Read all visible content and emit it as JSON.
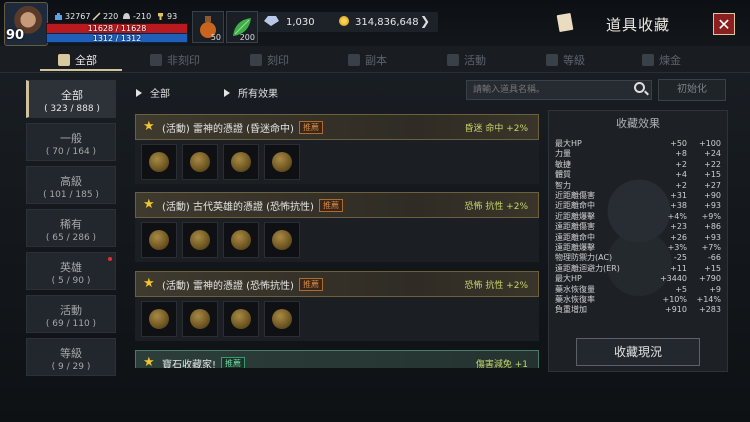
{
  "player": {
    "level": "90",
    "power": "32767",
    "attack": "220",
    "defense": "-210",
    "trophies": "93",
    "hp_text": "11628 / 11628",
    "mp_text": "1312 / 1312",
    "hp_fraction": 1.0,
    "mp_fraction": 1.0
  },
  "slots": [
    {
      "icon": "potion-icon",
      "qty": "50"
    },
    {
      "icon": "herb-icon",
      "qty": "200"
    }
  ],
  "currency": {
    "gems": "1,030",
    "gold": "314,836,648"
  },
  "header": {
    "title": "道具收藏"
  },
  "tabs": [
    {
      "label": "全部",
      "icon": "grid-icon",
      "active": true
    },
    {
      "label": "非刻印",
      "icon": "lock-icon"
    },
    {
      "label": "刻印",
      "icon": "lock-icon"
    },
    {
      "label": "副本",
      "icon": "gate-icon"
    },
    {
      "label": "活動",
      "icon": "sword-icon"
    },
    {
      "label": "等級",
      "icon": "level-icon"
    },
    {
      "label": "煉金",
      "icon": "gear-icon"
    }
  ],
  "categories": [
    {
      "name": "全部",
      "count": "( 323 / 888 )",
      "active": true
    },
    {
      "name": "一般",
      "count": "( 70 / 164 )"
    },
    {
      "name": "高級",
      "count": "( 101 / 185 )"
    },
    {
      "name": "稀有",
      "count": "( 65 / 286 )"
    },
    {
      "name": "英雄",
      "count": "( 5 / 90 )",
      "dot": true
    },
    {
      "name": "活動",
      "count": "( 69 / 110 )"
    },
    {
      "name": "等級",
      "count": "( 9 / 29 )"
    }
  ],
  "filters": {
    "all": "全部",
    "effect": "所有效果"
  },
  "search": {
    "placeholder": "請輸入道具名稱。"
  },
  "reset_label": "初始化",
  "sets": [
    {
      "name": "(活動) 雷神的憑證 (昏迷命中)",
      "tag": "推薦",
      "effect": "昏迷 命中 +2%",
      "items": 4
    },
    {
      "name": "(活動) 古代英雄的憑證 (恐怖抗性)",
      "tag": "推薦",
      "effect": "恐怖 抗性 +2%",
      "items": 4
    },
    {
      "name": "(活動) 雷神的憑證 (恐怖抗性)",
      "tag": "推薦",
      "effect": "恐怖 抗性 +2%",
      "items": 4
    },
    {
      "name": "寶石收藏家!",
      "tag": "推薦",
      "effect": "傷害減免 +1",
      "items": 0,
      "green": true
    }
  ],
  "panel": {
    "title": "收藏效果",
    "stats": [
      {
        "name": "最大HP",
        "v1": "+50",
        "v2": "+100"
      },
      {
        "name": "力量",
        "v1": "+8",
        "v2": "+24"
      },
      {
        "name": "敏捷",
        "v1": "+2",
        "v2": "+22"
      },
      {
        "name": "體質",
        "v1": "+4",
        "v2": "+15"
      },
      {
        "name": "智力",
        "v1": "+2",
        "v2": "+27"
      },
      {
        "name": "近距離傷害",
        "v1": "+31",
        "v2": "+90"
      },
      {
        "name": "近距離命中",
        "v1": "+38",
        "v2": "+93"
      },
      {
        "name": "近距離爆擊",
        "v1": "+4%",
        "v2": "+9%"
      },
      {
        "name": "遠距離傷害",
        "v1": "+23",
        "v2": "+86"
      },
      {
        "name": "遠距離命中",
        "v1": "+26",
        "v2": "+93"
      },
      {
        "name": "遠距離爆擊",
        "v1": "+3%",
        "v2": "+7%"
      },
      {
        "name": "物理防禦力(AC)",
        "v1": "-25",
        "v2": "-66"
      },
      {
        "name": "遠距離迴避力(ER)",
        "v1": "+11",
        "v2": "+15"
      },
      {
        "name": "最大HP",
        "v1": "+3440",
        "v2": "+790"
      },
      {
        "name": "藥水恢復量",
        "v1": "+5",
        "v2": "+9"
      },
      {
        "name": "藥水恢復率",
        "v1": "+10%",
        "v2": "+14%"
      },
      {
        "name": "負重增加",
        "v1": "+910",
        "v2": "+283"
      }
    ],
    "button": "收藏現況"
  }
}
